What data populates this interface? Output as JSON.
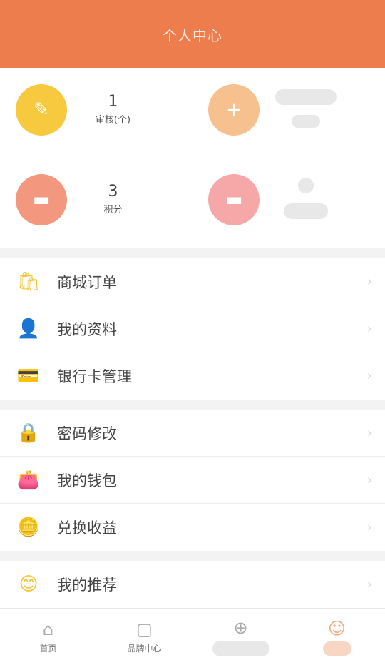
{
  "header": {
    "title": "个人中心"
  },
  "stats": [
    {
      "icon": "brush-icon",
      "icon_glyph": "✎",
      "value": "1",
      "label": "审核(个)",
      "color": "#f6c93e"
    },
    {
      "icon": "plus-circle-icon",
      "icon_glyph": "+",
      "value": "",
      "label": "",
      "color": "#f7c08f"
    },
    {
      "icon": "box-icon",
      "icon_glyph": "▬",
      "value": "3",
      "label": "积分",
      "color": "#f3987f"
    },
    {
      "icon": "box-icon-2",
      "icon_glyph": "▬",
      "value": "",
      "label": "",
      "color": "#f6a8a8"
    }
  ],
  "menu_sections": [
    [
      {
        "icon": "bag-icon",
        "glyph": "🛍",
        "label": "商城订单"
      },
      {
        "icon": "user-icon",
        "glyph": "👤",
        "label": "我的资料"
      },
      {
        "icon": "bank-card-icon",
        "glyph": "💳",
        "label": "银行卡管理"
      }
    ],
    [
      {
        "icon": "lock-icon",
        "glyph": "🔒",
        "label": "密码修改"
      },
      {
        "icon": "wallet-icon",
        "glyph": "👛",
        "label": "我的钱包"
      },
      {
        "icon": "coin-icon",
        "glyph": "🪙",
        "label": "兑换收益"
      }
    ],
    [
      {
        "icon": "recommend-icon",
        "glyph": "😊",
        "label": "我的推荐"
      }
    ]
  ],
  "tabbar": [
    {
      "icon": "home-icon",
      "glyph": "⌂",
      "label": "首页"
    },
    {
      "icon": "shop-icon",
      "glyph": "▢",
      "label": "品牌中心"
    },
    {
      "icon": "add-icon",
      "glyph": "⊕",
      "label": ""
    },
    {
      "icon": "profile-icon",
      "glyph": "☺",
      "label": ""
    }
  ],
  "colors": {
    "primary": "#ee7d4e",
    "bg": "#f3f3f3"
  }
}
